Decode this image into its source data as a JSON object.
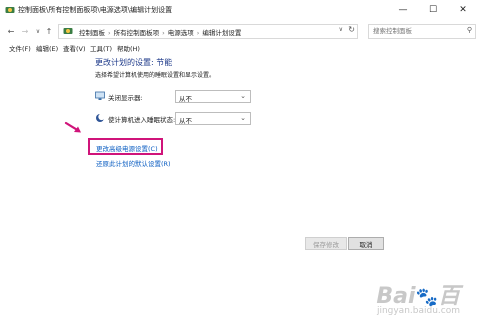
{
  "window": {
    "title": "控制面板\\所有控制面板项\\电源选项\\编辑计划设置",
    "minimize": "—",
    "maximize": "☐",
    "close": "✕"
  },
  "nav": {
    "back": "←",
    "forward": "→",
    "recent": "∨",
    "up": "↑"
  },
  "address": {
    "breadcrumbs": [
      "控制面板",
      "所有控制面板项",
      "电源选项",
      "编辑计划设置"
    ],
    "separator": "›",
    "dropdown": "∨",
    "refresh": "↻"
  },
  "search": {
    "placeholder": "搜索控制面板",
    "icon": "search-icon"
  },
  "menu": {
    "items": [
      "文件(F)",
      "编辑(E)",
      "查看(V)",
      "工具(T)",
      "帮助(H)"
    ]
  },
  "main": {
    "heading": "更改计划的设置: 节能",
    "subtitle": "选择希望计算机使用的睡眠设置和显示设置。",
    "rows": [
      {
        "label": "关闭显示器:",
        "value": "从不",
        "icon": "monitor-icon"
      },
      {
        "label": "使计算机进入睡眠状态:",
        "value": "从不",
        "icon": "moon-icon"
      }
    ],
    "advanced_link": "更改高级电源设置(C)",
    "restore_link": "还原此计划的默认设置(R)",
    "save_button": "保存修改",
    "cancel_button": "取消"
  },
  "annotation": {
    "color": "#d0147a"
  },
  "watermark": {
    "logo": "Bai",
    "logo_tail": "百",
    "sub": "jingyan.baidu.com"
  },
  "colors": {
    "heading": "#1e3a8a",
    "link": "#0a5dc2",
    "highlight": "#d0147a"
  }
}
